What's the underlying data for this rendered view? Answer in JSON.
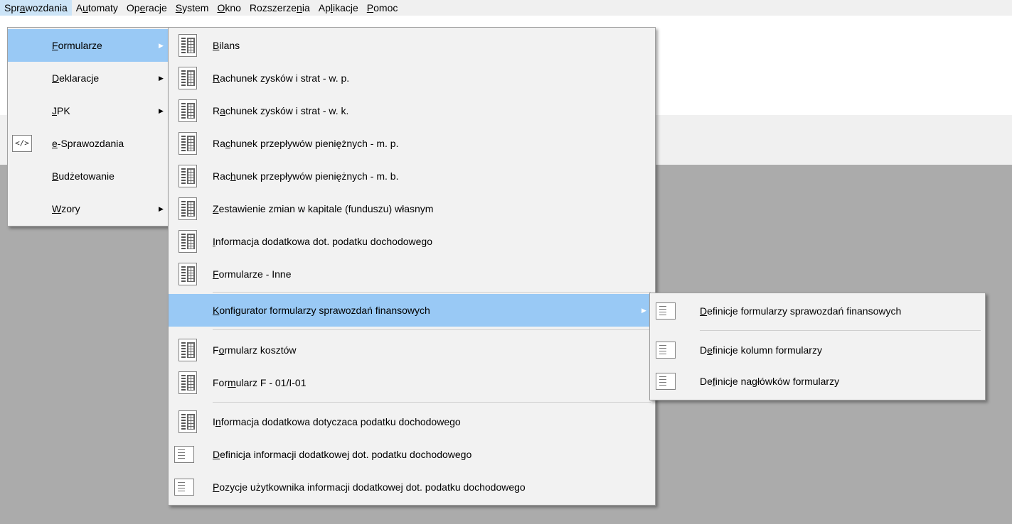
{
  "menubar": {
    "items": [
      {
        "pre": "Spr",
        "u": "a",
        "post": "wozdania"
      },
      {
        "pre": "A",
        "u": "u",
        "post": "tomaty"
      },
      {
        "pre": "Op",
        "u": "e",
        "post": "racje"
      },
      {
        "pre": "",
        "u": "S",
        "post": "ystem"
      },
      {
        "pre": "",
        "u": "O",
        "post": "kno"
      },
      {
        "pre": "Rozszerze",
        "u": "n",
        "post": "ia"
      },
      {
        "pre": "Ap",
        "u": "l",
        "post": "ikacje"
      },
      {
        "pre": "",
        "u": "P",
        "post": "omoc"
      }
    ]
  },
  "menu1": {
    "items": [
      {
        "pre": "",
        "u": "F",
        "post": "ormularze"
      },
      {
        "pre": "",
        "u": "D",
        "post": "eklaracje"
      },
      {
        "pre": "",
        "u": "J",
        "post": "PK"
      },
      {
        "pre": "",
        "u": "e",
        "post": "-Sprawozdania",
        "icon": "</>"
      },
      {
        "pre": "",
        "u": "B",
        "post": "udżetowanie"
      },
      {
        "pre": "",
        "u": "W",
        "post": "zory"
      }
    ]
  },
  "menu2": {
    "items": [
      {
        "pre": "",
        "u": "B",
        "post": "ilans"
      },
      {
        "pre": "",
        "u": "R",
        "post": "achunek zysków i strat - w. p."
      },
      {
        "pre": "R",
        "u": "a",
        "post": "chunek zysków i strat - w. k."
      },
      {
        "pre": "Ra",
        "u": "c",
        "post": "hunek przepływów pieniężnych - m. p."
      },
      {
        "pre": "Rac",
        "u": "h",
        "post": "unek przepływów pieniężnych - m. b."
      },
      {
        "pre": "",
        "u": "Z",
        "post": "estawienie zmian w kapitale (funduszu) własnym"
      },
      {
        "pre": "",
        "u": "I",
        "post": "nformacja dodatkowa dot. podatku dochodowego"
      },
      {
        "pre": "",
        "u": "F",
        "post": "ormularze - Inne"
      },
      {
        "pre": "",
        "u": "K",
        "post": "onfigurator formularzy sprawozdań finansowych"
      },
      {
        "pre": "F",
        "u": "o",
        "post": "rmularz kosztów"
      },
      {
        "pre": "For",
        "u": "m",
        "post": "ularz F - 01/I-01"
      },
      {
        "pre": "I",
        "u": "n",
        "post": "formacja dodatkowa dotyczaca podatku dochodowego"
      },
      {
        "pre": "",
        "u": "D",
        "post": "efinicja informacji dodatkowej dot. podatku dochodowego"
      },
      {
        "pre": "",
        "u": "P",
        "post": "ozycje użytkownika informacji dodatkowej dot. podatku dochodowego"
      }
    ]
  },
  "menu3": {
    "items": [
      {
        "pre": "",
        "u": "D",
        "post": "efinicje formularzy sprawozdań finansowych"
      },
      {
        "pre": "D",
        "u": "e",
        "post": "finicje kolumn formularzy"
      },
      {
        "pre": "De",
        "u": "f",
        "post": "inicje nagłówków formularzy"
      }
    ]
  },
  "icons": {
    "report_form": "grid-form-icon",
    "definition": "list-document-icon",
    "xml": "code-icon",
    "submenu": "submenu-arrow-icon"
  },
  "colors": {
    "highlight": "#99c9f5",
    "menu_bg": "#f2f2f2",
    "desktop": "#ababab"
  }
}
